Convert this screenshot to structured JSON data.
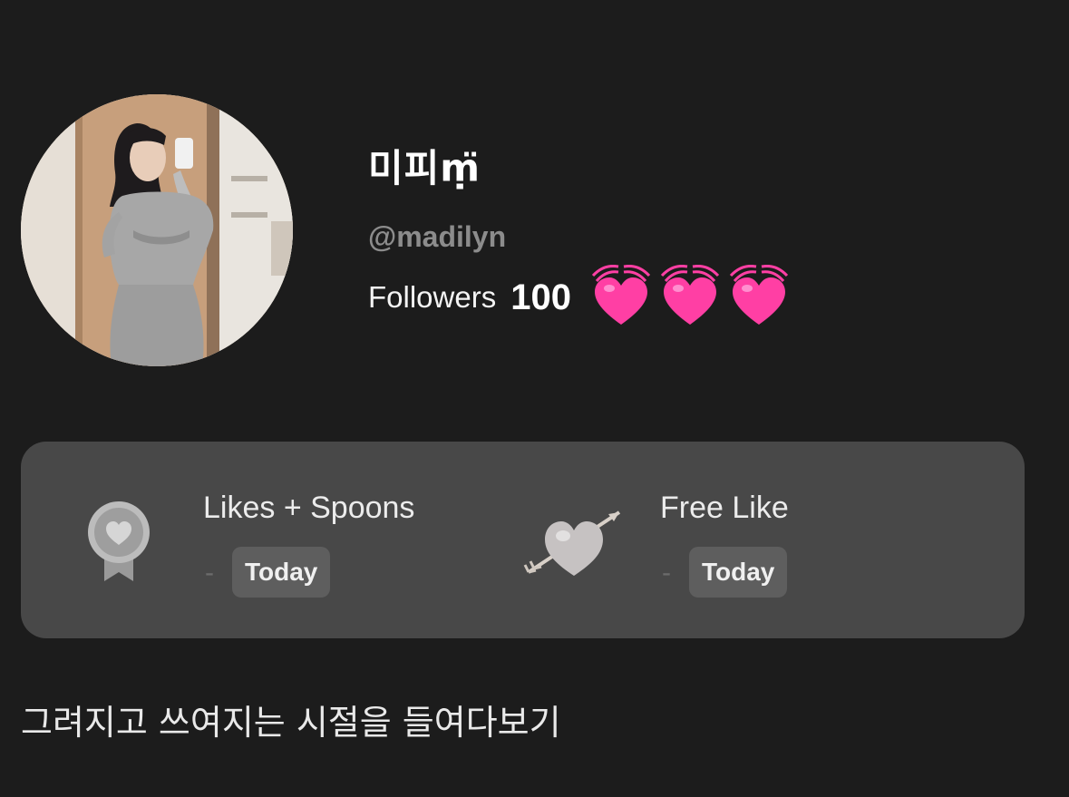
{
  "profile": {
    "display_name": "미피ṃ̈",
    "handle": "@madilyn",
    "followers_label": "Followers",
    "followers_count": "100",
    "hearts": [
      "heart-with-waves-icon",
      "heart-with-waves-icon",
      "heart-with-waves-icon"
    ],
    "bio": "그려지고 쓰여지는 시절을 들여다보기"
  },
  "stats": [
    {
      "title": "Likes + Spoons",
      "dash": "-",
      "badge": "Today",
      "icon": "medal-heart-icon"
    },
    {
      "title": "Free Like",
      "dash": "-",
      "badge": "Today",
      "icon": "heart-arrow-icon"
    }
  ],
  "colors": {
    "background": "#1c1c1c",
    "card": "#484848",
    "badge": "#5e5e5e",
    "handle": "#8c8c8c",
    "heart": "#ff3fa4"
  }
}
